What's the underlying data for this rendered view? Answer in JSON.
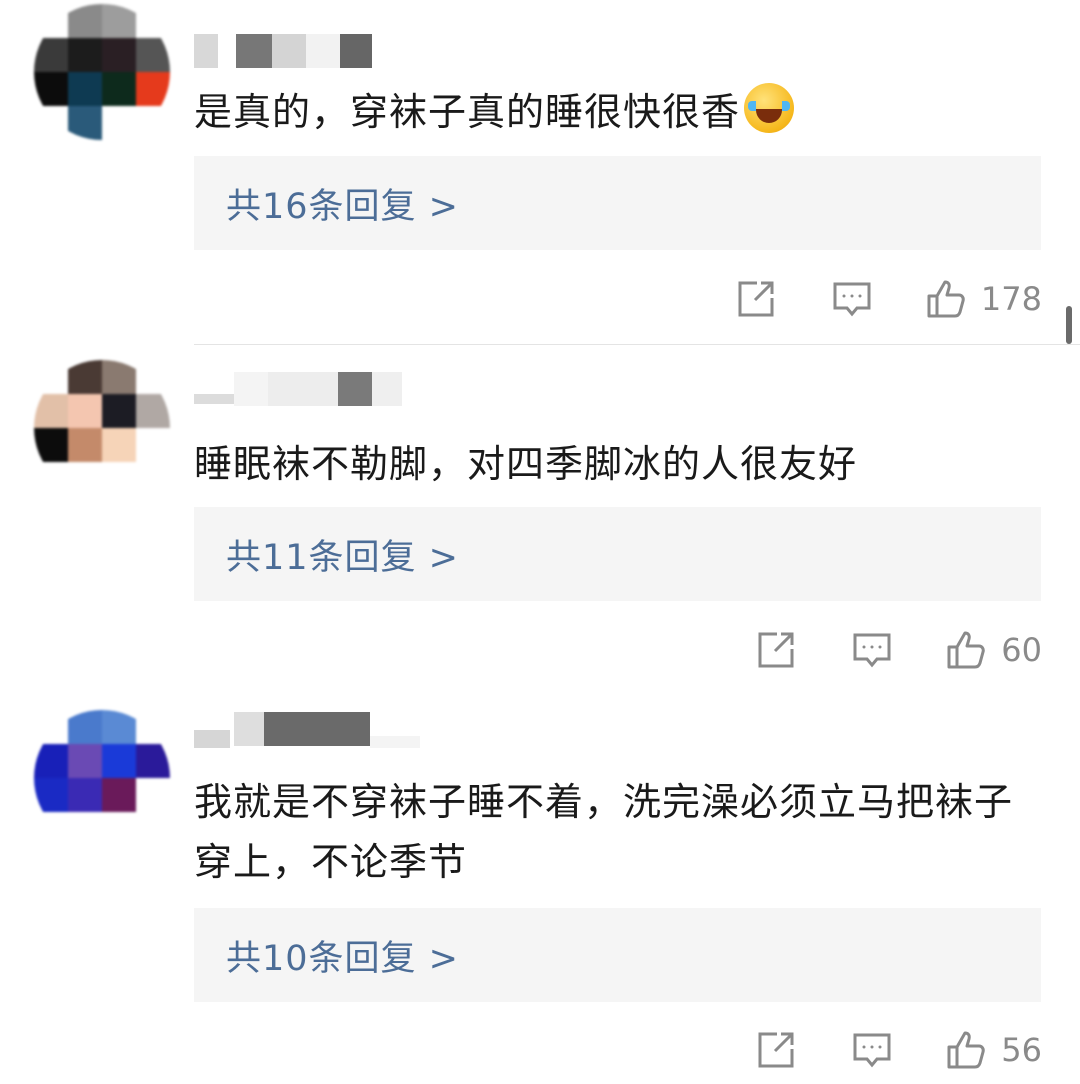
{
  "comments": [
    {
      "text": "是真的，穿袜子真的睡很快很香",
      "emoji": "rolling-laughing-crying-emoji",
      "replies_label": "共16条回复 >",
      "likes": "178"
    },
    {
      "text": "睡眠袜不勒脚，对四季脚冰的人很友好",
      "replies_label": "共11条回复 >",
      "likes": "60"
    },
    {
      "text": "我就是不穿袜子睡不着，洗完澡必须立马把袜子穿上，不论季节",
      "replies_label": "共10条回复 >",
      "likes": "56"
    }
  ],
  "icons": {
    "share": "share-icon",
    "comment": "comment-icon",
    "like": "thumbs-up-icon"
  },
  "colors": {
    "link": "#4c6d97",
    "reply_box": "#f5f5f5",
    "icon": "#8a8a8a"
  }
}
